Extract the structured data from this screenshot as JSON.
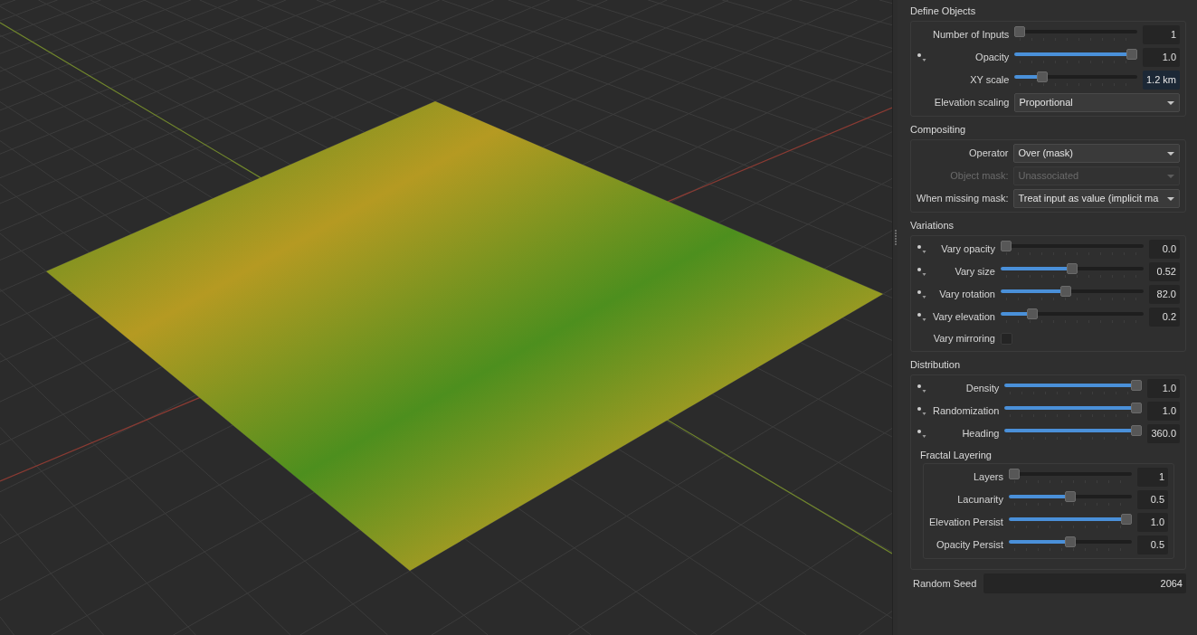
{
  "sections": [
    {
      "title": "Define Objects",
      "rows": [
        {
          "kind": "slider",
          "label": "Number of Inputs",
          "animatable": false,
          "level": 0,
          "value": "1",
          "focused": false
        },
        {
          "kind": "slider",
          "label": "Opacity",
          "animatable": true,
          "level": 1,
          "value": "1.0",
          "focused": false
        },
        {
          "kind": "slider",
          "label": "XY scale",
          "animatable": false,
          "level": 0.2,
          "value": "1.2 km",
          "focused": true
        },
        {
          "kind": "dropdown",
          "label": "Elevation scaling",
          "value": "Proportional",
          "disabled": false
        }
      ]
    },
    {
      "title": "Compositing",
      "rows": [
        {
          "kind": "dropdown",
          "label": "Operator",
          "value": "Over (mask)",
          "disabled": false
        },
        {
          "kind": "dropdown",
          "label": "Object mask:",
          "value": "Unassociated",
          "disabled": true
        },
        {
          "kind": "dropdown",
          "label": "When missing mask:",
          "value": "Treat input as value (implicit ma",
          "disabled": false
        }
      ]
    },
    {
      "title": "Variations",
      "rows": [
        {
          "kind": "slider",
          "label": "Vary opacity",
          "animatable": true,
          "level": 0,
          "value": "0.0",
          "focused": false
        },
        {
          "kind": "slider",
          "label": "Vary size",
          "animatable": true,
          "level": 0.5,
          "value": "0.52",
          "focused": false
        },
        {
          "kind": "slider",
          "label": "Vary rotation",
          "animatable": true,
          "level": 0.45,
          "value": "82.0",
          "focused": false
        },
        {
          "kind": "slider",
          "label": "Vary elevation",
          "animatable": true,
          "level": 0.2,
          "value": "0.2",
          "focused": false
        },
        {
          "kind": "checkbox",
          "label": "Vary mirroring",
          "checked": false
        }
      ]
    },
    {
      "title": "Distribution",
      "rows": [
        {
          "kind": "slider",
          "label": "Density",
          "animatable": true,
          "level": 1,
          "value": "1.0",
          "focused": false
        },
        {
          "kind": "slider",
          "label": "Randomization",
          "animatable": true,
          "level": 1,
          "value": "1.0",
          "focused": false
        },
        {
          "kind": "slider",
          "label": "Heading",
          "animatable": true,
          "level": 1,
          "value": "360.0",
          "focused": false
        },
        {
          "kind": "group",
          "title": "Fractal Layering",
          "rows": [
            {
              "kind": "slider",
              "label": "Layers",
              "animatable": false,
              "level": 0,
              "value": "1",
              "focused": false
            },
            {
              "kind": "slider",
              "label": "Lacunarity",
              "animatable": false,
              "level": 0.5,
              "value": "0.5",
              "focused": false
            },
            {
              "kind": "slider",
              "label": "Elevation Persist",
              "animatable": false,
              "level": 1,
              "value": "1.0",
              "focused": false
            },
            {
              "kind": "slider",
              "label": "Opacity Persist",
              "animatable": false,
              "level": 0.5,
              "value": "0.5",
              "focused": false
            }
          ]
        }
      ]
    }
  ],
  "random_seed": {
    "label": "Random Seed",
    "value": "2064"
  }
}
